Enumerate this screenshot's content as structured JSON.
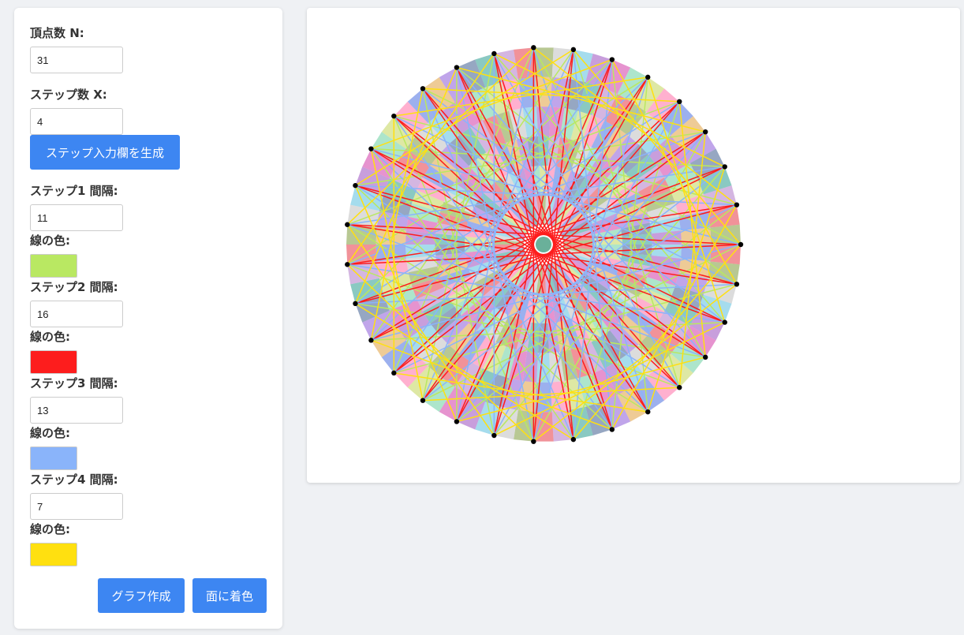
{
  "controls": {
    "vertex_label": "頂点数 N:",
    "vertex_value": "31",
    "step_count_label": "ステップ数 X:",
    "step_count_value": "4",
    "generate_button": "ステップ入力欄を生成",
    "steps": [
      {
        "label": "ステップ1 間隔:",
        "value": "11",
        "color_label": "線の色:",
        "color": "#b9e862"
      },
      {
        "label": "ステップ2 間隔:",
        "value": "16",
        "color_label": "線の色:",
        "color": "#fd1d1d"
      },
      {
        "label": "ステップ3 間隔:",
        "value": "13",
        "color_label": "線の色:",
        "color": "#8ab4fa"
      },
      {
        "label": "ステップ4 間隔:",
        "value": "7",
        "color_label": "線の色:",
        "color": "#ffe010"
      }
    ],
    "draw_button": "グラフ作成",
    "fill_button": "面に着色"
  },
  "graph": {
    "vertices": 31,
    "steps": [
      11,
      16,
      13,
      7
    ],
    "step_colors": [
      "#b9e862",
      "#fd1d1d",
      "#8ab4fa",
      "#ffe010"
    ],
    "vertex_color": "#000000",
    "face_colors": [
      "#e63946",
      "#2a9d8f",
      "#8d5bd8",
      "#4a6fe0",
      "#c2d65a",
      "#d13aa8",
      "#5bc0de",
      "#7e9b3a",
      "#b07ac9",
      "#3f5f8f",
      "#e0a040",
      "#ff6fa8",
      "#6ad0a0",
      "#9a4fbf",
      "#c0c0c0"
    ]
  }
}
